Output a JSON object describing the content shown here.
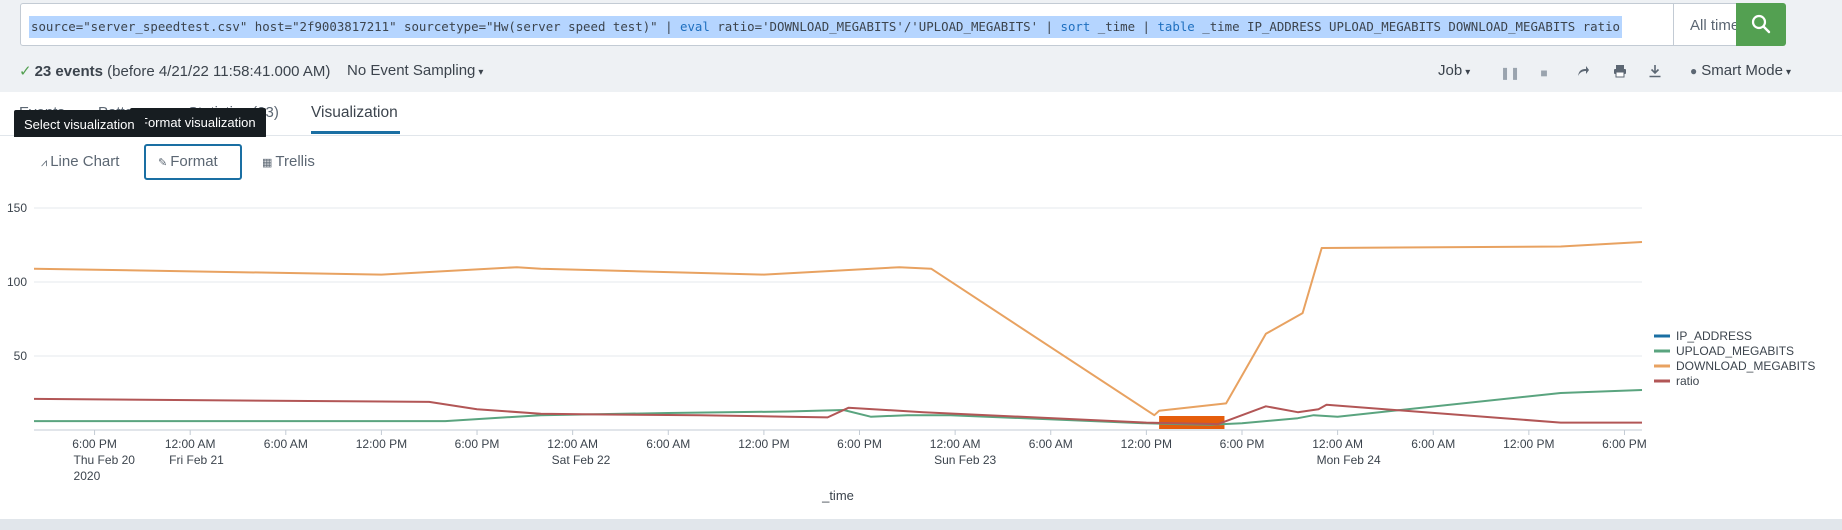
{
  "search": {
    "query_parts": [
      {
        "text": "source=\"server_speedtest.csv\" host=\"2f9003817211\" sourcetype=\"Hw(server speed test)\" | ",
        "kw": false
      },
      {
        "text": "eval",
        "kw": true
      },
      {
        "text": " ratio='DOWNLOAD_MEGABITS'/'UPLOAD_MEGABITS' | ",
        "kw": false
      },
      {
        "text": "sort",
        "kw": true
      },
      {
        "text": " _time | ",
        "kw": false
      },
      {
        "text": "table",
        "kw": true
      },
      {
        "text": " _time IP_ADDRESS UPLOAD_MEGABITS DOWNLOAD_MEGABITS ratio",
        "kw": false
      }
    ],
    "time_range": "All time",
    "search_icon": "search-icon"
  },
  "status": {
    "events_count": "23 events",
    "events_detail": "(before 4/21/22 11:58:41.000 AM)",
    "sampling": "No Event Sampling",
    "job_label": "Job",
    "smart_mode": "Smart Mode"
  },
  "tabs": {
    "events": "Events",
    "patterns": "Patterns",
    "statistics": "Statistics (23)",
    "visualization": "Visualization"
  },
  "tooltips": {
    "select_viz": "Select visualization",
    "format_viz": "Format visualization"
  },
  "viz_toolbar": {
    "line_chart": "Line Chart",
    "format": "Format",
    "trellis": "Trellis"
  },
  "colors": {
    "accent": "#1a6fa3",
    "search_green": "#53a051",
    "upload": "#5aa47f",
    "download": "#e8a261",
    "ratio": "#b25656",
    "ip": "#1a6fa3",
    "selection": "#e55d0c"
  },
  "chart_data": {
    "type": "line",
    "xlabel": "_time",
    "ylabel": "",
    "ylim": [
      0,
      150
    ],
    "y_ticks": [
      50,
      100,
      150
    ],
    "grid": true,
    "legend_position": "right",
    "x_tick_labels": [
      [
        "6:00 PM",
        "Thu Feb 20",
        "2020"
      ],
      [
        "12:00 AM",
        "Fri Feb 21"
      ],
      [
        "6:00 AM"
      ],
      [
        "12:00 PM"
      ],
      [
        "6:00 PM"
      ],
      [
        "12:00 AM",
        "Sat Feb 22"
      ],
      [
        "6:00 AM"
      ],
      [
        "12:00 PM"
      ],
      [
        "6:00 PM"
      ],
      [
        "12:00 AM",
        "Sun Feb 23"
      ],
      [
        "6:00 AM"
      ],
      [
        "12:00 PM"
      ],
      [
        "6:00 PM"
      ],
      [
        "12:00 AM",
        "Mon Feb 24"
      ],
      [
        "6:00 AM"
      ],
      [
        "12:00 PM"
      ],
      [
        "6:00 PM"
      ]
    ],
    "x_tick_hours": [
      18,
      24,
      30,
      36,
      42,
      48,
      54,
      60,
      66,
      72,
      78,
      84,
      90,
      96,
      102,
      108,
      114
    ],
    "x_range_hours": [
      14.2,
      115.1
    ],
    "selection_hours": [
      84.8,
      88.9
    ],
    "series": [
      {
        "name": "IP_ADDRESS",
        "x": [],
        "y": []
      },
      {
        "name": "UPLOAD_MEGABITS",
        "x": [
          14.2,
          40.0,
          46.0,
          54.0,
          61.5,
          65.0,
          66.7,
          69.0,
          71.7,
          84.0,
          86.0,
          88.0,
          90.0,
          93.5,
          94.5,
          96.0,
          110.0,
          115.1
        ],
        "y": [
          6,
          6,
          10,
          11.5,
          12.5,
          13.5,
          9,
          10,
          10,
          4.5,
          4,
          3.5,
          4.5,
          8,
          10,
          9,
          25,
          27
        ]
      },
      {
        "name": "DOWNLOAD_MEGABITS",
        "x": [
          14.2,
          36.0,
          44.5,
          46.0,
          60.0,
          68.5,
          70.5,
          84.5,
          84.8,
          89.0,
          91.5,
          93.8,
          95.0,
          110.0,
          115.1
        ],
        "y": [
          109,
          105,
          110,
          109,
          105,
          110,
          109,
          10,
          13,
          18,
          65,
          79,
          123,
          124,
          127
        ]
      },
      {
        "name": "ratio",
        "x": [
          14.2,
          39.0,
          42.0,
          46.0,
          50.0,
          56.0,
          61.5,
          64.0,
          65.3,
          70.0,
          84.0,
          88.5,
          91.5,
          93.5,
          94.8,
          95.3,
          110.0,
          115.1
        ],
        "y": [
          21,
          19,
          14,
          11,
          10.5,
          10,
          9,
          8.5,
          15,
          12,
          5,
          4,
          16,
          12,
          14,
          17,
          5,
          5
        ]
      }
    ]
  }
}
